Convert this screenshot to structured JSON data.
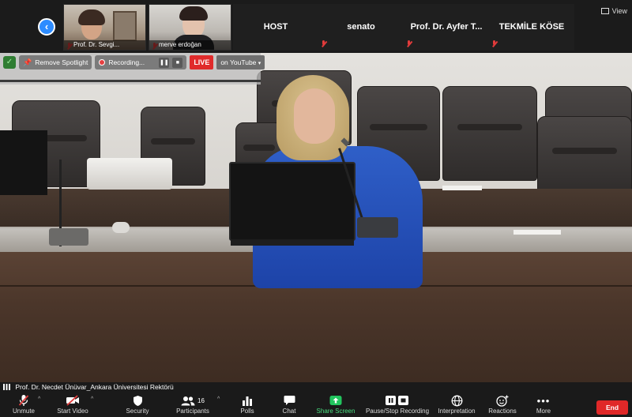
{
  "top_strip": {
    "thumbnails": [
      {
        "name": "Prof. Dr. Sevgi..."
      },
      {
        "name": "merve erdoğan"
      }
    ],
    "name_tiles": [
      "HOST",
      "senato",
      "Prof. Dr. Ayfer T...",
      "TEKMİLE KÖSE"
    ],
    "view_label": "View"
  },
  "float_bar": {
    "remove_spotlight": "Remove Spotlight",
    "recording": "Recording...",
    "pause_icon": "pause-icon",
    "stop_icon": "stop-icon",
    "live": "LIVE",
    "live_platform": "on YouTube"
  },
  "speaker_name": "Prof. Dr. Necdet Ünüvar_Ankara  Üniversitesi Rektörü",
  "controls": [
    {
      "label": "Unmute",
      "icon": "mic-muted-icon"
    },
    {
      "label": "Start Video",
      "icon": "camera-off-icon"
    },
    {
      "label": "Security",
      "icon": "shield-icon"
    },
    {
      "label": "Participants",
      "icon": "participants-icon",
      "count": "16"
    },
    {
      "label": "Polls",
      "icon": "polls-icon"
    },
    {
      "label": "Chat",
      "icon": "chat-icon"
    },
    {
      "label": "Share Screen",
      "icon": "share-screen-icon"
    },
    {
      "label": "Pause/Stop Recording",
      "icon": "recording-icon"
    },
    {
      "label": "Interpretation",
      "icon": "globe-icon"
    },
    {
      "label": "Reactions",
      "icon": "reactions-icon"
    },
    {
      "label": "More",
      "icon": "more-icon"
    }
  ],
  "end_label": "End",
  "colors": {
    "accent": "#2d8cff",
    "live": "#e02b2b",
    "share": "#22c55e",
    "end": "#e02828"
  }
}
